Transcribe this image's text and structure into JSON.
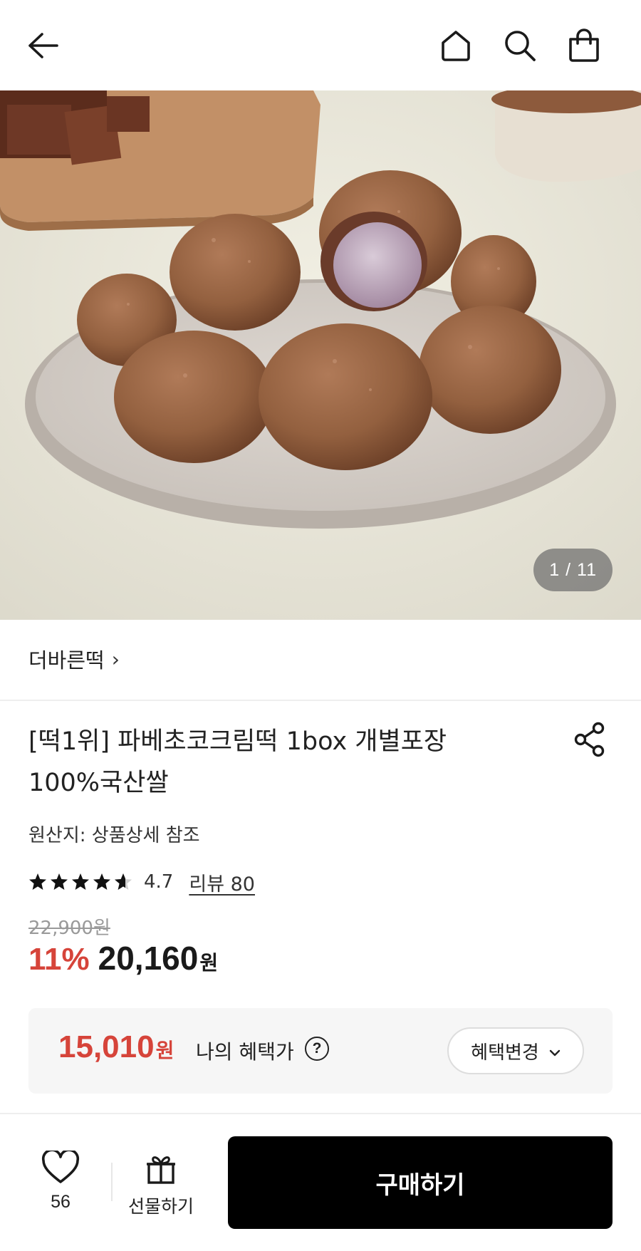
{
  "header": {
    "icons": [
      "back-arrow-icon",
      "home-icon",
      "search-icon",
      "shopping-bag-icon"
    ]
  },
  "gallery": {
    "counter": "1 / 11"
  },
  "product": {
    "brand": "더바른떡",
    "brand_chevron": "›",
    "title_line1": "[떡1위] 파베초코크림떡 1box 개별포장",
    "title_line2": "100%국산쌀",
    "origin": "원산지: 상품상세 참조",
    "rating": {
      "stars": 4.7,
      "score": "4.7",
      "review_link": "리뷰 80"
    },
    "original_price": "22,900원",
    "discount": "11%",
    "price": "20,160",
    "price_unit": "원"
  },
  "benefit": {
    "price": "15,010",
    "price_unit": "원",
    "label": "나의 혜택가",
    "help_glyph": "?",
    "change_button": "혜택변경"
  },
  "bottom_bar": {
    "like_count": "56",
    "gift_label": "선물하기",
    "buy_label": "구매하기"
  },
  "colors": {
    "accent_red": "#d6443a",
    "buy_button": "#000000"
  }
}
